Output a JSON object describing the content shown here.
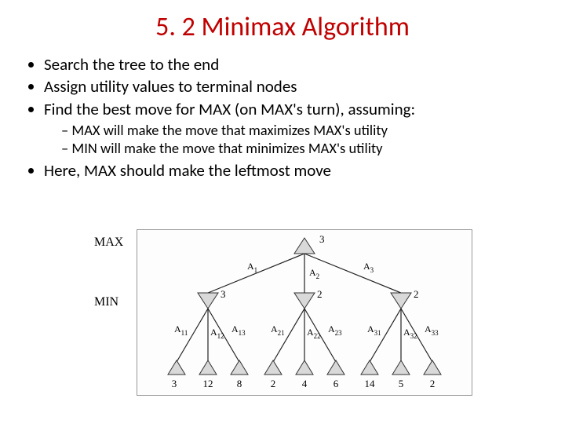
{
  "title": "5. 2 Minimax Algorithm",
  "bullets": {
    "b1": "Search the tree to the end",
    "b2": "Assign utility values to terminal nodes",
    "b3": "Find the best move for MAX (on MAX's turn), assuming:",
    "s1": "MAX will make the move that maximizes MAX's utility",
    "s2": "MIN will make the move that minimizes MAX's utility",
    "b4": "Here, MAX should make the leftmost move"
  },
  "figure": {
    "side_max": "MAX",
    "side_min": "MIN",
    "root_value": "3",
    "actions_top": {
      "a1": "A",
      "a1s": "1",
      "a2": "A",
      "a2s": "2",
      "a3": "A",
      "a3s": "3"
    },
    "min_values": {
      "m1": "3",
      "m2": "2",
      "m3": "2"
    },
    "actions_bottom": {
      "a11": "A",
      "a11s": "11",
      "a12": "A",
      "a12s": "12",
      "a13": "A",
      "a13s": "13",
      "a21": "A",
      "a21s": "21",
      "a22": "A",
      "a22s": "22",
      "a23": "A",
      "a23s": "23",
      "a31": "A",
      "a31s": "31",
      "a32": "A",
      "a32s": "32",
      "a33": "A",
      "a33s": "33"
    },
    "leaf_values": {
      "l11": "3",
      "l12": "12",
      "l13": "8",
      "l21": "2",
      "l22": "4",
      "l23": "6",
      "l31": "14",
      "l32": "5",
      "l33": "2"
    }
  }
}
